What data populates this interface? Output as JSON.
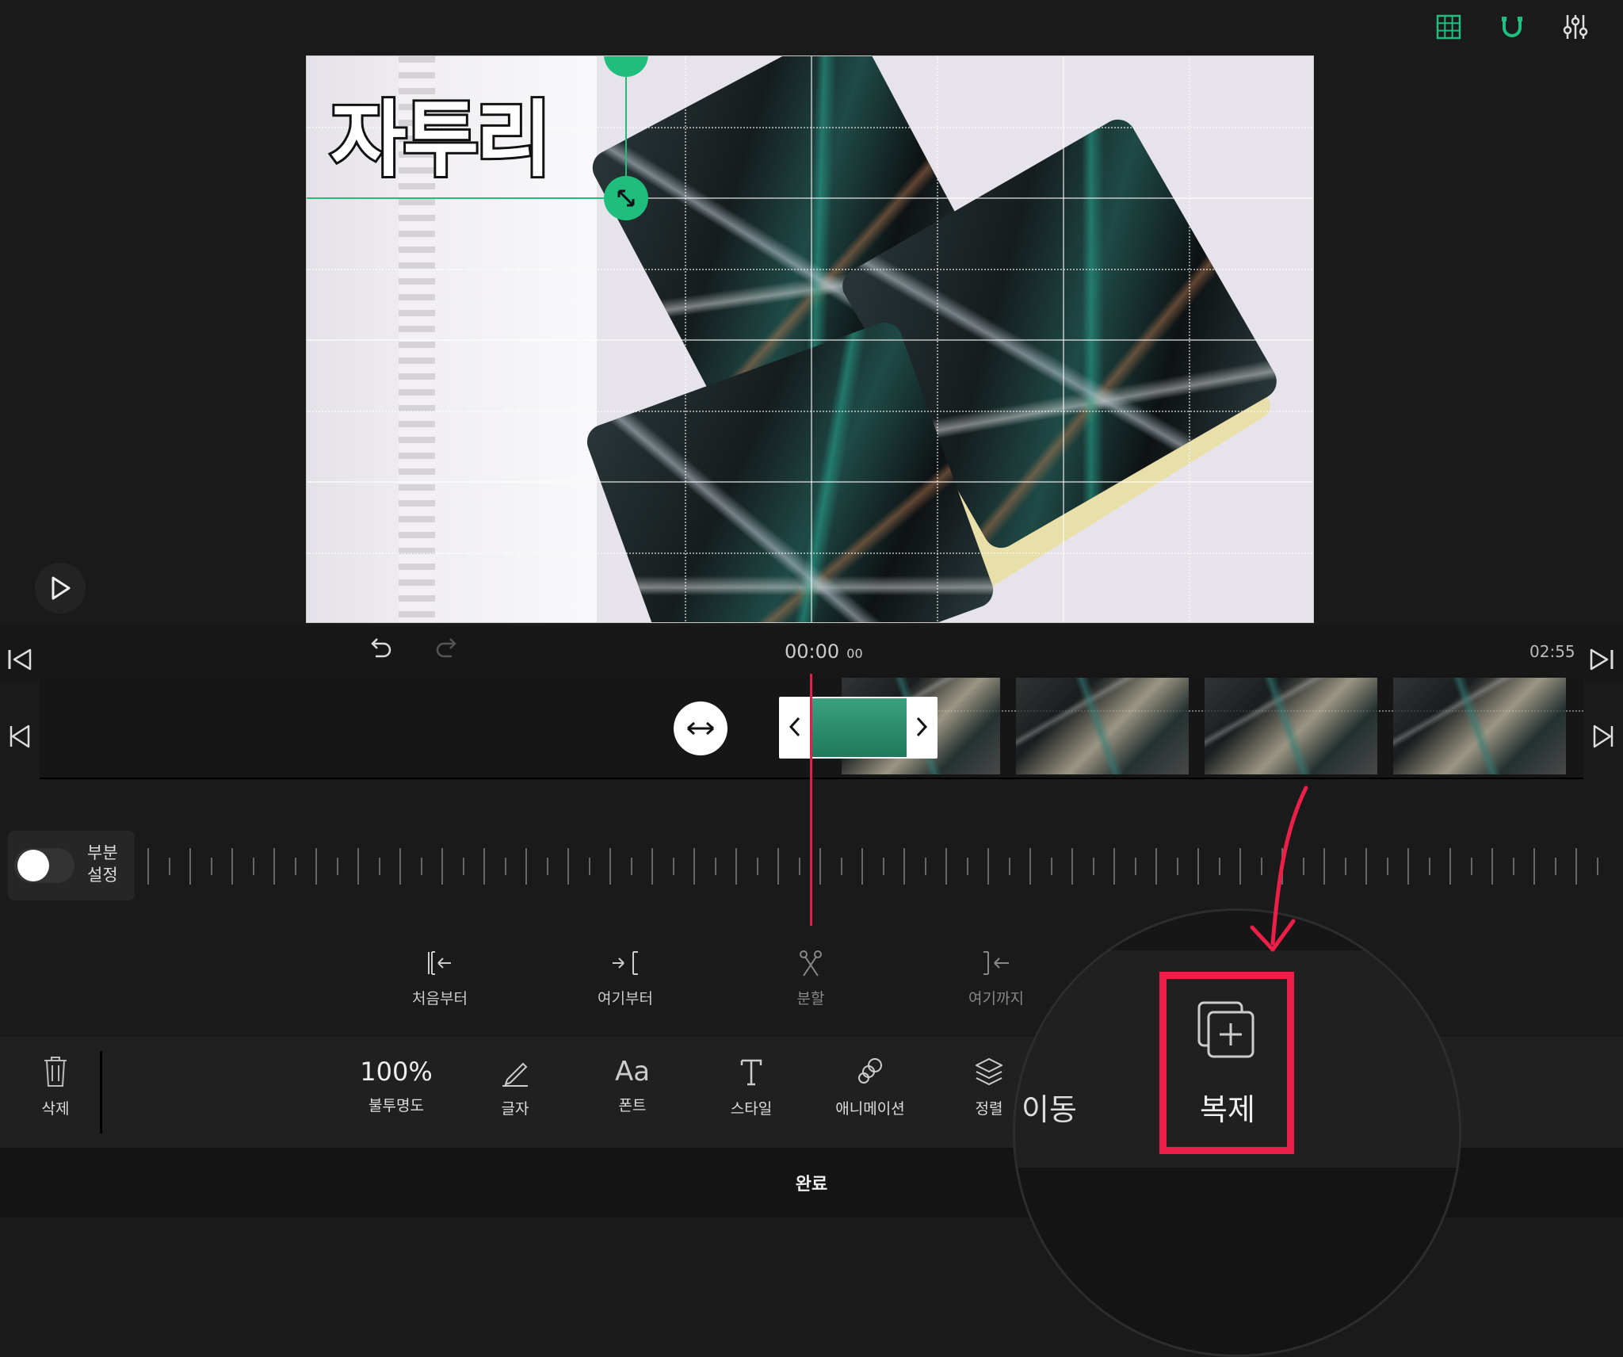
{
  "top_icons": [
    "grid-icon",
    "magnet-icon",
    "sliders-icon"
  ],
  "preview": {
    "overlay_text": "자투리"
  },
  "timeline": {
    "current_time": "00:00",
    "current_frames": "00",
    "total_time": "02:55"
  },
  "partial": {
    "label_line1": "부분",
    "label_line2": "설정"
  },
  "actions": [
    {
      "label": "처음부터",
      "icon": "trim-start-icon"
    },
    {
      "label": "여기부터",
      "icon": "from-here-icon"
    },
    {
      "label": "분할",
      "icon": "split-icon"
    },
    {
      "label": "여기까지",
      "icon": "to-here-icon"
    }
  ],
  "toolbar": {
    "delete": "삭제",
    "opacity_value": "100%",
    "opacity": "불투명도",
    "text": "글자",
    "font": "폰트",
    "font_glyph": "Aa",
    "style": "스타일",
    "animation": "애니메이션",
    "align": "정렬",
    "move_partial": "이동",
    "duplicate": "복제",
    "done": "완료"
  },
  "colors": {
    "accent": "#1fbe7e",
    "playhead": "#e0204a",
    "highlight": "#ec1f48"
  }
}
